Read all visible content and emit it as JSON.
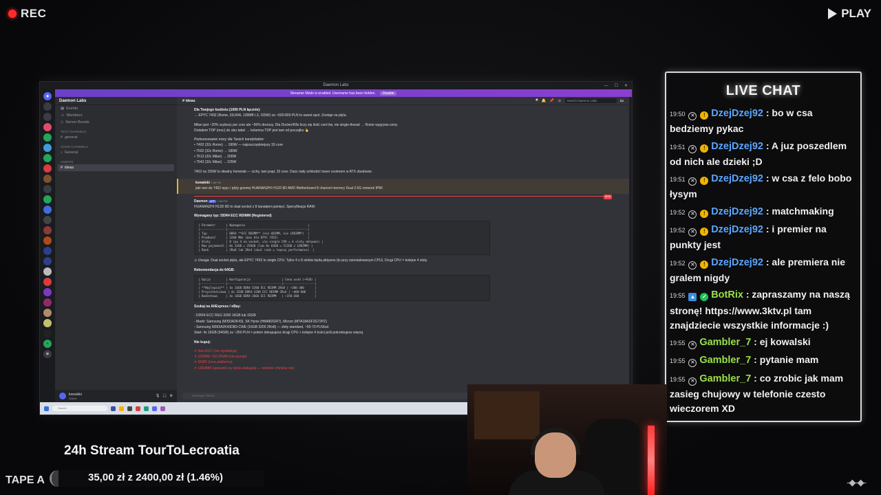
{
  "overlay": {
    "rec_label": "REC",
    "play_label": "PLAY",
    "tape_label": "TAPE A",
    "stream_title": "24h Stream TourToLecroatia",
    "goal_text": "35,00 zł z 2400,00 zł (1.46%)",
    "goal_fraction": 0.0146,
    "corner_glyph": "-◆-◆-"
  },
  "discord": {
    "window_title": "Daemon Labs",
    "streamer_mode_text": "Streamer Mode is enabled. Username has been hidden.",
    "streamer_mode_button": "Disable",
    "server_name": "Daemon Labs",
    "nav": [
      "Events",
      "Members",
      "Server Boosts"
    ],
    "text_channels_header": "Text Channels",
    "channel_general": "general",
    "voice_channels_header": "Voice Channels",
    "voice_general": "General",
    "agents_header": "Agents",
    "active_channel": "ideas",
    "channel_title": "ideas",
    "search_placeholder": "Search Daemon Labs",
    "user_name": "kowalski",
    "user_status": "Online",
    "input_placeholder": "Message #ideas",
    "taskbar_search": "Search",
    "messages": {
      "m1_bold": "Dla Twojego budżetu (1000 PLN łącznie):",
      "m1_line": "→ EPYC 7402 (Rome, 32c/64t, 128MB L3, 155W) za ~600-800 PLN to sweet spot. Zostaje na płyta.",
      "m2_line": "Milan jest ~20% szybszy per core ale ~50% droższy. Dla Docker/K8s liczy się ilość core'ów, nie single-thread → Rome wygrywa cenę.",
      "m3_line": "Dodałem TDP (moc) do obu tabel → kolumna TDP jest tam od początku 👆",
      "m4_italic": "Podsumowanie mocy dla Twoich kandydatów:",
      "bullets": [
        "7402 (32c Rome) → 180W — najoszczędniejszy 32-core",
        "7502 (32c Rome) → 180W",
        "7513 (32c Milan) → 200W",
        "7543 (32c Milan) → 225W"
      ],
      "m5_line": "7402 na 155W to idealny homelab — cichy, tani prąd, 32 core. Dasz radę schłodzić tower coolerem w ATX obudowie.",
      "reply_user": "kowalski",
      "reply_time": "1:56 PM",
      "reply_text": "jaki ram do 7452 epyc i płyty gownej HUANANZHI H12D 8D AMD Motherboard 8 channel memory Dual 2.5G network IPMI",
      "new_tag": "NEW",
      "bot_user": "Daemon",
      "bot_tag": "APP",
      "bot_time": "1:56 PM",
      "bot_intro": "HUANANZHI H12D 8D to dual socket z 8 kanałami pamięci. Specyfikacja RAM:",
      "req_label": "Wymagany typ: DDR4 ECC RDIMM (Registered)",
      "code1": "| Parametr      | Wymaganie                                    |\n|---------------|----------------------------------------------|\n| Typ           | DDR4 **ECC RDIMM** (nie UDIMM, nie LRDIMM*)  |\n| Prędkość      | 3200 MHz (max dla EPYC 7452)                 |\n| Sloty         | 8 (po 4 na socket, vie single CPU = 4 sloty aktywne) |\n| Max pojemność | 8x 32GB = 256GB (lub 8x 64GB = 512GB z LRDIMM) |\n| Rank          | 2Rx8 lub 2Rx4 (dual rank = lepszy performance)  |",
      "warn_line": "⚠ Uwaga: Dual socket płyta, ale EPYC 7452 to single CPU. Tylko 4 z 8 slotów będą aktywne (te przy zainstalowanym CPU). Drugi CPU = kolejne 4 sloty.",
      "rec_label": "Rekomendacja do 64GB:",
      "code2": "| Opcja         | Konfiguracja                  | Cena used (~PLN) |\n|---------------|-------------------------------|------------------|\n| **Najlepsza** | 4x 16GB DDR4-3200 ECC RDIMM 2Rx8 | ~200-300      |\n| Przyszłościowa | 4x 32GB DDR4-3200 ECC RDIMM 2Rx4 | ~400-600     |\n| Budżetowa     | 4x 16GB DDR4-2666 ECC RDIMM   | ~150-200         |",
      "search_label": "Szukaj na AliExpress / eBay:",
      "search_line1": "- DDR4 ECC REG 3200 16GB lub 32GB",
      "search_line2": "- Marki: Samsung (M393A2K43), SK Hynix (HMA82GR7), Micron (MTA18ASF2G72PZ)",
      "search_line3": "- Samsung M393A2K43DB3-CWE (16GB 3200 2Rx8) — złoty standard, ~50-70 PLN/szt",
      "start_line": "Start: 4x 16GB (64GB) za ~250 PLN = potem dokupujesz drugi CPU + kolejne 4 kości jeśli potrzebujesz więcej.",
      "nobuy_label": "Nie kupuj:",
      "nobuy": [
        "✕ Non-ECC (nie wystartuje)",
        "✕ UDIMM / SO-DIMM (nie pasuje)",
        "✕ DDR5 (inna platforma)",
        "✕ LRDIMM (sprawdź czy płyta obsługuje — niektóre chińskie nie)"
      ],
      "last_time": "1:56 PM"
    }
  },
  "live_chat": {
    "title": "LIVE CHAT",
    "messages": [
      {
        "time": "19:50",
        "user": "DzejDzej92",
        "text": ": bo w csa bedziemy pykac",
        "color": "blue"
      },
      {
        "time": "19:51",
        "user": "DzejDzej92",
        "text": ": A juz poszedlem od nich ale dzieki ;D",
        "color": "blue"
      },
      {
        "time": "19:51",
        "user": "DzejDzej92",
        "text": ": w csa z felo bobo łysym",
        "color": "blue"
      },
      {
        "time": "19:52",
        "user": "DzejDzej92",
        "text": ": matchmaking",
        "color": "blue"
      },
      {
        "time": "19:52",
        "user": "DzejDzej92",
        "text": ": i premier na punkty jest",
        "color": "blue"
      },
      {
        "time": "19:52",
        "user": "DzejDzej92",
        "text": ": ale premiera nie gralem nigdy",
        "color": "blue"
      },
      {
        "time": "19:55",
        "user": "BotRix",
        "text": ": zapraszamy na naszą stronę! https://www.3ktv.pl tam znajdziecie wszystkie informacje :)",
        "color": "green"
      },
      {
        "time": "19:55",
        "user": "Gambler_7",
        "text": ": ej kowalski",
        "color": "green"
      },
      {
        "time": "19:55",
        "user": "Gambler_7",
        "text": ": pytanie mam",
        "color": "green"
      },
      {
        "time": "19:55",
        "user": "Gambler_7",
        "text": ": co zrobic jak mam zasieg chujowy w telefonie czesto wieczorem XD",
        "color": "green"
      }
    ]
  }
}
